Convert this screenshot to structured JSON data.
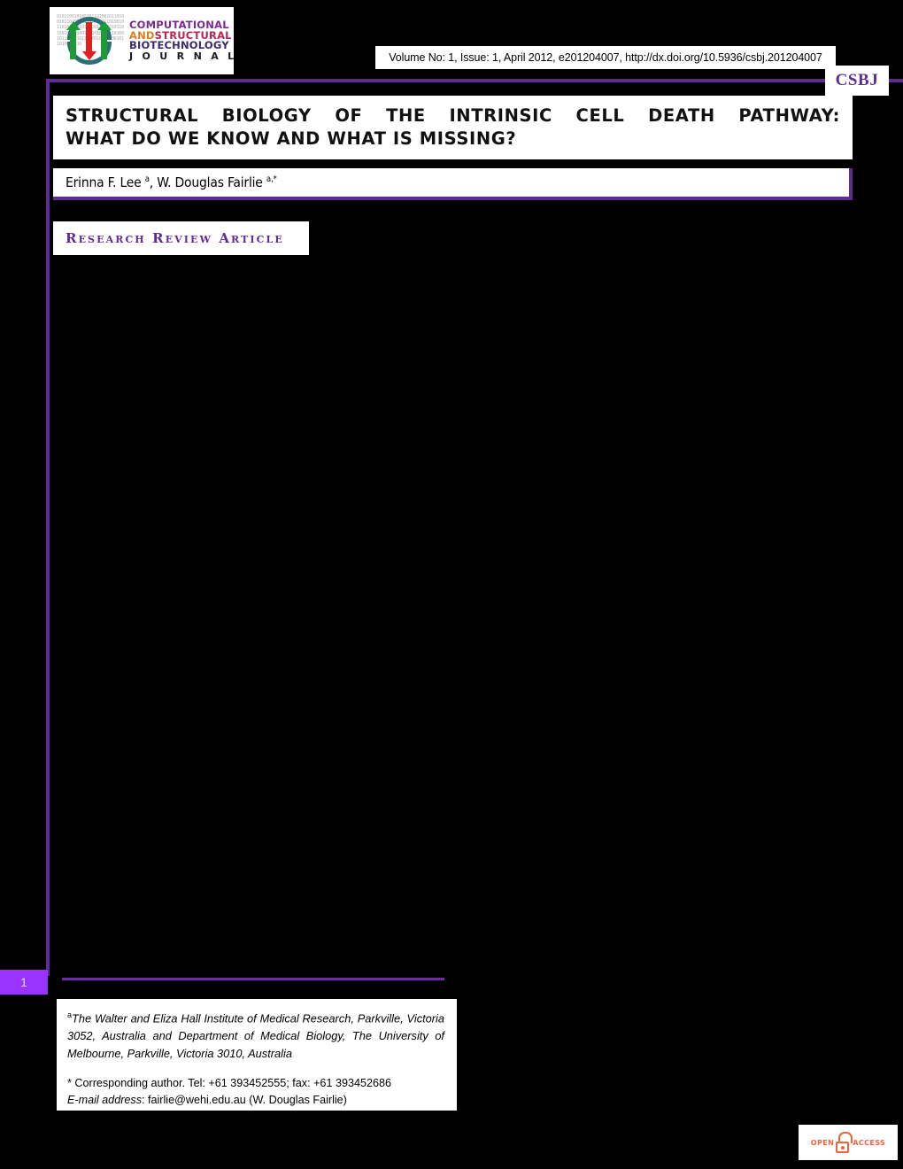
{
  "journal": {
    "logo_lines": [
      "COMPUTATIONAL",
      "AND",
      "STRUCTURAL",
      "BIOTECHNOLOGY",
      "J O U R N A L"
    ],
    "logo_colors": {
      "computational": "#7a2b8f",
      "and": "#d98020",
      "structural": "#b8245b",
      "biotechnology": "#3b2a6b",
      "journal": "#1a1a1a"
    },
    "abbrev_tab": "CSBJ"
  },
  "banner": {
    "citation": "Volume No: 1, Issue: 1, April 2012, e201204007, http://dx.doi.org/10.5936/csbj.201204007"
  },
  "article": {
    "title_line_1": "STRUCTURAL BIOLOGY OF THE INTRINSIC CELL DEATH PATHWAY:",
    "title_line_2": "WHAT DO WE KNOW AND WHAT IS MISSING?",
    "authors_text": "Erinna F. Lee ",
    "author_1_sup": "a",
    "authors_text_2": ", W. Douglas Fairlie ",
    "author_2_sup": "a,*",
    "type_badge": "Research Review Article"
  },
  "footer": {
    "affiliation_sup": "a",
    "affiliation": "The Walter and Eliza Hall Institute of Medical Research, Parkville, Victoria 3052, Australia and Department of Medical Biology, The University of Melbourne, Parkville, Victoria 3010, Australia",
    "corresponding": "* Corresponding author. Tel: +61 393452555; fax: +61 393452686",
    "email_label": "E-mail address",
    "email_value": ": fairlie@wehi.edu.au (W. Douglas Fairlie)",
    "page_number": "1"
  },
  "badges": {
    "open_access_left": "OPEN",
    "open_access_right": "ACCESS"
  },
  "theme": {
    "purple": "#5f2c95",
    "bright_purple": "#9933ff",
    "orange": "#f4623a",
    "background": "#000000",
    "paper": "#ffffff"
  }
}
